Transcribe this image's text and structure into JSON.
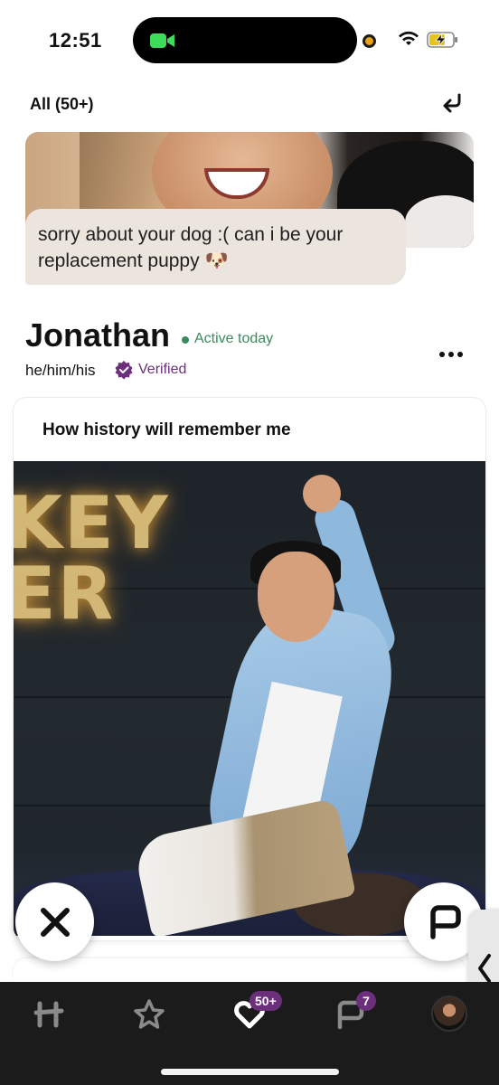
{
  "status_bar": {
    "time": "12:51",
    "icons": [
      "facetime-icon",
      "recording-dot",
      "wifi-icon",
      "battery-charging-icon"
    ]
  },
  "header": {
    "filter_label": "All (50+)",
    "undo_icon": "undo-arrow-icon"
  },
  "liked_item": {
    "comment": "sorry about your dog :( can i be your replacement puppy 🐶"
  },
  "profile": {
    "name": "Jonathan",
    "activity": "Active today",
    "pronouns": "he/him/his",
    "verified_label": "Verified"
  },
  "prompt_card": {
    "title": "How history will remember me"
  },
  "tab_bar": {
    "tabs": [
      {
        "name": "home",
        "icon": "hinge-logo-icon"
      },
      {
        "name": "standouts",
        "icon": "star-icon"
      },
      {
        "name": "likes",
        "icon": "heart-icon",
        "badge": "50+"
      },
      {
        "name": "matches",
        "icon": "chat-icon",
        "badge": "7"
      },
      {
        "name": "profile",
        "icon": "avatar"
      }
    ]
  },
  "colors": {
    "accent_purple": "#6b2f7c",
    "active_green": "#3a8a5c",
    "tab_bar_bg": "#1b1b1b",
    "comment_bubble_bg": "#ece5de"
  }
}
